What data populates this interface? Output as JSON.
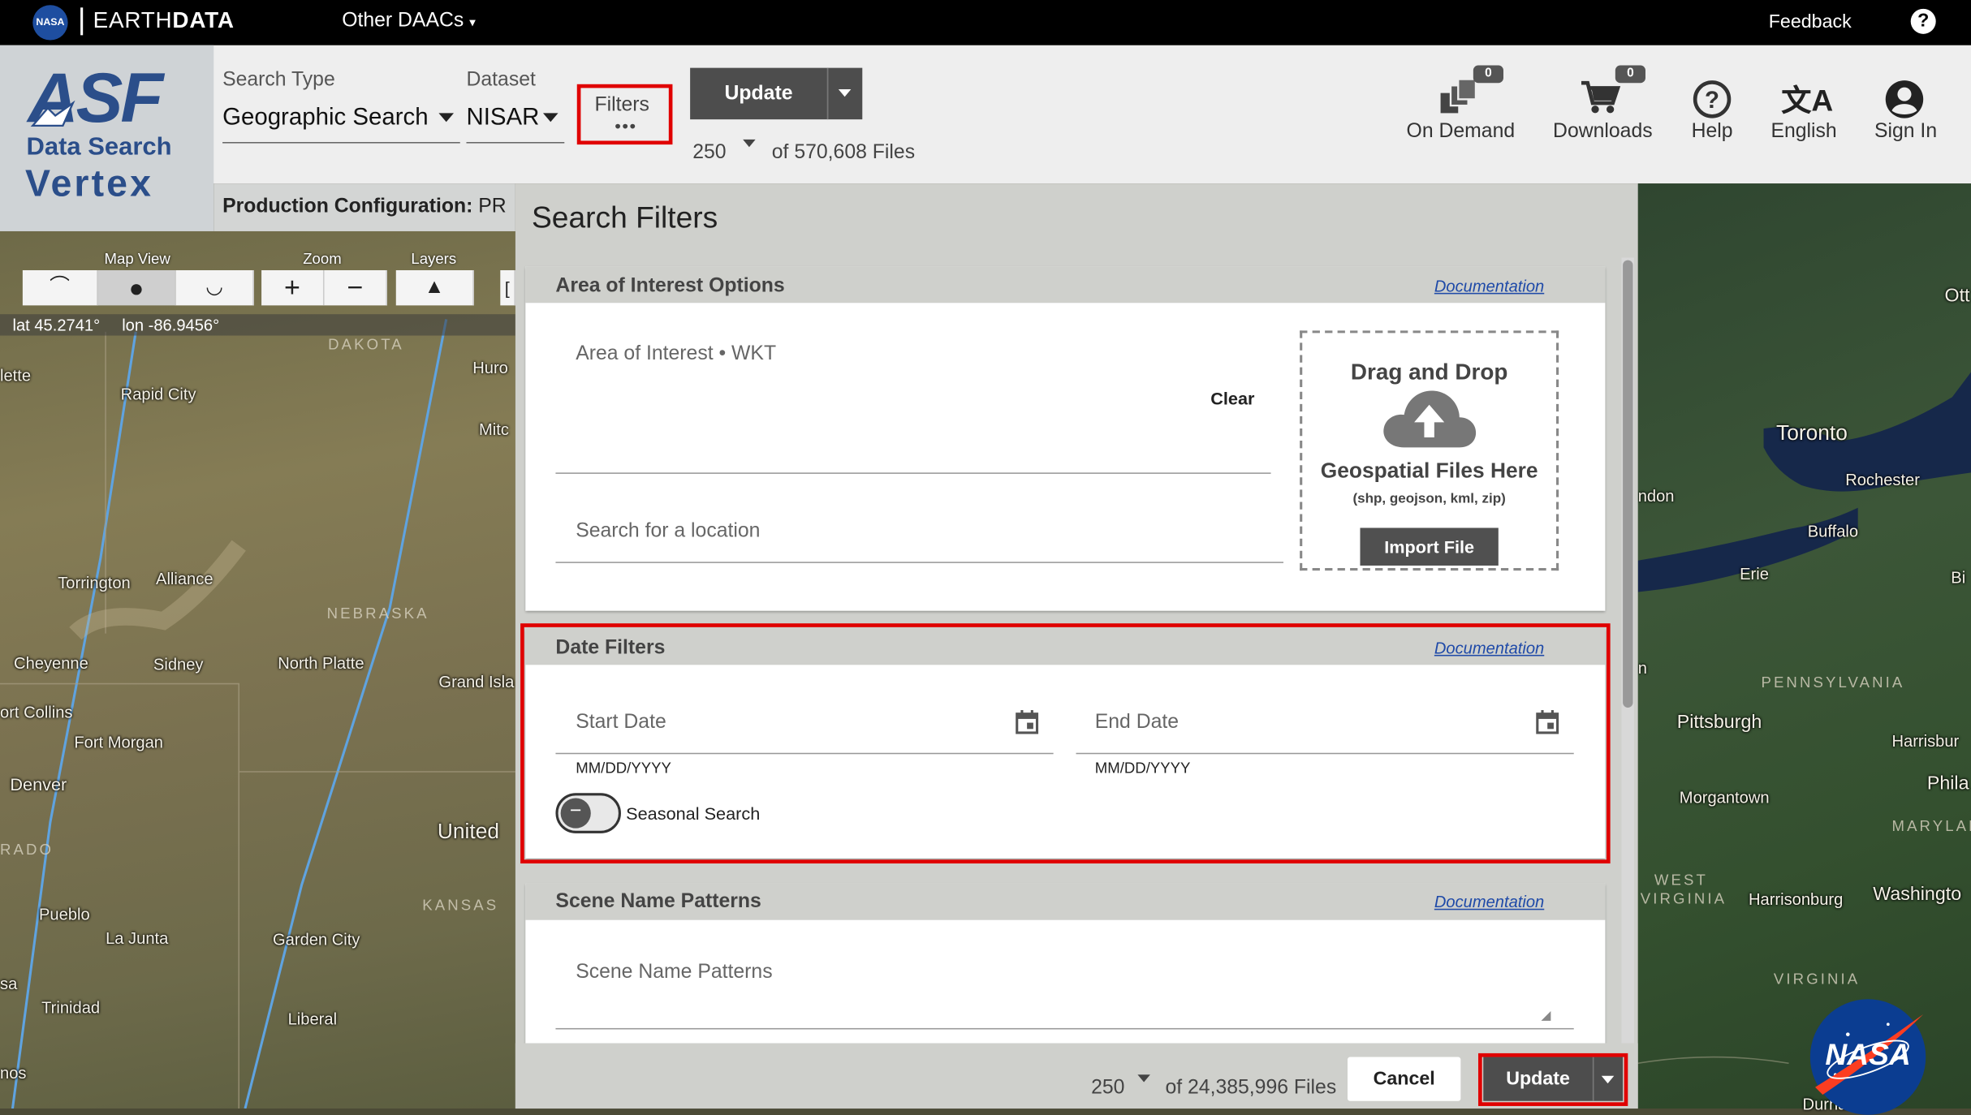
{
  "topbar": {
    "nasa_badge": "NASA",
    "brand_prefix": "EARTH",
    "brand_suffix": "DATA",
    "other_daacs": "Other DAACs",
    "feedback": "Feedback",
    "help_glyph": "?"
  },
  "logo": {
    "asf": "ASF",
    "data_search": "Data Search",
    "vertex": "Vertex"
  },
  "search": {
    "search_type_label": "Search Type",
    "search_type_value": "Geographic Search",
    "dataset_label": "Dataset",
    "dataset_value": "NISAR",
    "filters_label": "Filters",
    "filters_dots": "•••",
    "update_label": "Update",
    "max_results": "250",
    "files_count": "of 570,608 Files",
    "production_label": "Production Configuration:",
    "production_value": "PR"
  },
  "header_actions": {
    "on_demand": {
      "label": "On Demand",
      "badge": "0",
      "icon": "layers-icon"
    },
    "downloads": {
      "label": "Downloads",
      "badge": "0",
      "icon": "cart-icon"
    },
    "help": {
      "label": "Help",
      "icon": "help-icon"
    },
    "language": {
      "label": "English",
      "icon": "translate-icon"
    },
    "sign_in": {
      "label": "Sign In",
      "icon": "account-icon"
    }
  },
  "map_controls": {
    "map_view_label": "Map View",
    "zoom_label": "Zoom",
    "layers_label": "Layers",
    "zoom_in": "+",
    "zoom_out": "−",
    "lat": "lat 45.2741°",
    "lon": "lon -86.9456°"
  },
  "map_labels_left": {
    "dakota": "DAKOTA",
    "huron": "Huro",
    "lette": "lette",
    "rapid_city": "Rapid City",
    "mitch": "Mitc",
    "torrington": "Torrington",
    "alliance": "Alliance",
    "nebraska": "NEBRASKA",
    "cheyenne": "Cheyenne",
    "sidney": "Sidney",
    "north_platte": "North Platte",
    "grand_island": "Grand Isla",
    "fort_collins": "ort Collins",
    "fort_morgan": "Fort Morgan",
    "denver": "Denver",
    "rado": "RADO",
    "united": "United",
    "kansas": "KANSAS",
    "pueblo": "Pueblo",
    "la_junta": "La Junta",
    "garden_city": "Garden City",
    "sa": "sa",
    "trinidad": "Trinidad",
    "liberal": "Liberal",
    "nos": "nos"
  },
  "map_labels_right": {
    "ott": "Ott",
    "toronto": "Toronto",
    "rochester": "Rochester",
    "ndon": "ndon",
    "buffalo": "Buffalo",
    "erie": "Erie",
    "bi": "Bi",
    "n": "n",
    "pennsylvania": "PENNSYLVANIA",
    "pittsburgh": "Pittsburgh",
    "harrisburg": "Harrisbur",
    "phila": "Phila",
    "morgantown": "Morgantown",
    "maryland": "MARYLAN",
    "west_virginia_1": "WEST",
    "west_virginia_2": "VIRGINIA",
    "harrisonburg": "Harrisonburg",
    "washington": "Washingto",
    "virginia": "VIRGINIA",
    "durham": "Durham"
  },
  "filters_panel": {
    "title": "Search Filters",
    "aoi": {
      "title": "Area of Interest Options",
      "doc": "Documentation",
      "wkt_placeholder": "Area of Interest • WKT",
      "clear": "Clear",
      "location_placeholder": "Search for a location",
      "dnd_title": "Drag and Drop",
      "dnd_subtitle": "Geospatial Files Here",
      "dnd_types": "(shp, geojson, kml, zip)",
      "import": "Import File"
    },
    "date": {
      "title": "Date Filters",
      "doc": "Documentation",
      "start_placeholder": "Start Date",
      "start_hint": "MM/DD/YYYY",
      "end_placeholder": "End Date",
      "end_hint": "MM/DD/YYYY",
      "seasonal": "Seasonal Search",
      "toggle_glyph": "−"
    },
    "scene": {
      "title": "Scene Name Patterns",
      "doc": "Documentation",
      "placeholder": "Scene Name Patterns"
    },
    "footer": {
      "max_results": "250",
      "files_count": "of 24,385,996 Files",
      "cancel": "Cancel",
      "update": "Update"
    }
  },
  "nasa_logo": "NASA",
  "colors": {
    "accent_red": "#e00000",
    "asf_blue": "#2b4e8a",
    "button_dark": "#4d4d4d",
    "doc_link": "#1f4aa8"
  }
}
